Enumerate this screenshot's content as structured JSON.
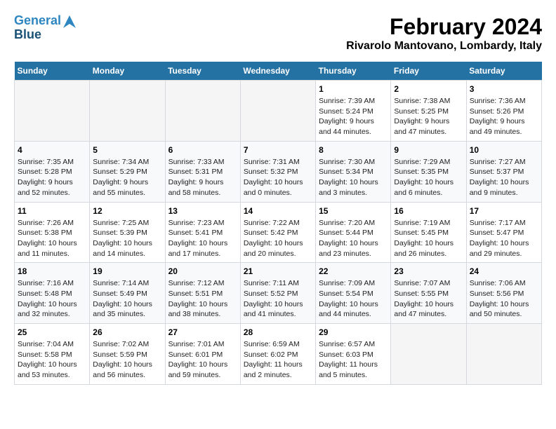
{
  "logo": {
    "line1": "General",
    "line2": "Blue"
  },
  "title": "February 2024",
  "subtitle": "Rivarolo Mantovano, Lombardy, Italy",
  "weekdays": [
    "Sunday",
    "Monday",
    "Tuesday",
    "Wednesday",
    "Thursday",
    "Friday",
    "Saturday"
  ],
  "weeks": [
    [
      {
        "day": "",
        "info": ""
      },
      {
        "day": "",
        "info": ""
      },
      {
        "day": "",
        "info": ""
      },
      {
        "day": "",
        "info": ""
      },
      {
        "day": "1",
        "info": "Sunrise: 7:39 AM\nSunset: 5:24 PM\nDaylight: 9 hours and 44 minutes."
      },
      {
        "day": "2",
        "info": "Sunrise: 7:38 AM\nSunset: 5:25 PM\nDaylight: 9 hours and 47 minutes."
      },
      {
        "day": "3",
        "info": "Sunrise: 7:36 AM\nSunset: 5:26 PM\nDaylight: 9 hours and 49 minutes."
      }
    ],
    [
      {
        "day": "4",
        "info": "Sunrise: 7:35 AM\nSunset: 5:28 PM\nDaylight: 9 hours and 52 minutes."
      },
      {
        "day": "5",
        "info": "Sunrise: 7:34 AM\nSunset: 5:29 PM\nDaylight: 9 hours and 55 minutes."
      },
      {
        "day": "6",
        "info": "Sunrise: 7:33 AM\nSunset: 5:31 PM\nDaylight: 9 hours and 58 minutes."
      },
      {
        "day": "7",
        "info": "Sunrise: 7:31 AM\nSunset: 5:32 PM\nDaylight: 10 hours and 0 minutes."
      },
      {
        "day": "8",
        "info": "Sunrise: 7:30 AM\nSunset: 5:34 PM\nDaylight: 10 hours and 3 minutes."
      },
      {
        "day": "9",
        "info": "Sunrise: 7:29 AM\nSunset: 5:35 PM\nDaylight: 10 hours and 6 minutes."
      },
      {
        "day": "10",
        "info": "Sunrise: 7:27 AM\nSunset: 5:37 PM\nDaylight: 10 hours and 9 minutes."
      }
    ],
    [
      {
        "day": "11",
        "info": "Sunrise: 7:26 AM\nSunset: 5:38 PM\nDaylight: 10 hours and 11 minutes."
      },
      {
        "day": "12",
        "info": "Sunrise: 7:25 AM\nSunset: 5:39 PM\nDaylight: 10 hours and 14 minutes."
      },
      {
        "day": "13",
        "info": "Sunrise: 7:23 AM\nSunset: 5:41 PM\nDaylight: 10 hours and 17 minutes."
      },
      {
        "day": "14",
        "info": "Sunrise: 7:22 AM\nSunset: 5:42 PM\nDaylight: 10 hours and 20 minutes."
      },
      {
        "day": "15",
        "info": "Sunrise: 7:20 AM\nSunset: 5:44 PM\nDaylight: 10 hours and 23 minutes."
      },
      {
        "day": "16",
        "info": "Sunrise: 7:19 AM\nSunset: 5:45 PM\nDaylight: 10 hours and 26 minutes."
      },
      {
        "day": "17",
        "info": "Sunrise: 7:17 AM\nSunset: 5:47 PM\nDaylight: 10 hours and 29 minutes."
      }
    ],
    [
      {
        "day": "18",
        "info": "Sunrise: 7:16 AM\nSunset: 5:48 PM\nDaylight: 10 hours and 32 minutes."
      },
      {
        "day": "19",
        "info": "Sunrise: 7:14 AM\nSunset: 5:49 PM\nDaylight: 10 hours and 35 minutes."
      },
      {
        "day": "20",
        "info": "Sunrise: 7:12 AM\nSunset: 5:51 PM\nDaylight: 10 hours and 38 minutes."
      },
      {
        "day": "21",
        "info": "Sunrise: 7:11 AM\nSunset: 5:52 PM\nDaylight: 10 hours and 41 minutes."
      },
      {
        "day": "22",
        "info": "Sunrise: 7:09 AM\nSunset: 5:54 PM\nDaylight: 10 hours and 44 minutes."
      },
      {
        "day": "23",
        "info": "Sunrise: 7:07 AM\nSunset: 5:55 PM\nDaylight: 10 hours and 47 minutes."
      },
      {
        "day": "24",
        "info": "Sunrise: 7:06 AM\nSunset: 5:56 PM\nDaylight: 10 hours and 50 minutes."
      }
    ],
    [
      {
        "day": "25",
        "info": "Sunrise: 7:04 AM\nSunset: 5:58 PM\nDaylight: 10 hours and 53 minutes."
      },
      {
        "day": "26",
        "info": "Sunrise: 7:02 AM\nSunset: 5:59 PM\nDaylight: 10 hours and 56 minutes."
      },
      {
        "day": "27",
        "info": "Sunrise: 7:01 AM\nSunset: 6:01 PM\nDaylight: 10 hours and 59 minutes."
      },
      {
        "day": "28",
        "info": "Sunrise: 6:59 AM\nSunset: 6:02 PM\nDaylight: 11 hours and 2 minutes."
      },
      {
        "day": "29",
        "info": "Sunrise: 6:57 AM\nSunset: 6:03 PM\nDaylight: 11 hours and 5 minutes."
      },
      {
        "day": "",
        "info": ""
      },
      {
        "day": "",
        "info": ""
      }
    ]
  ]
}
